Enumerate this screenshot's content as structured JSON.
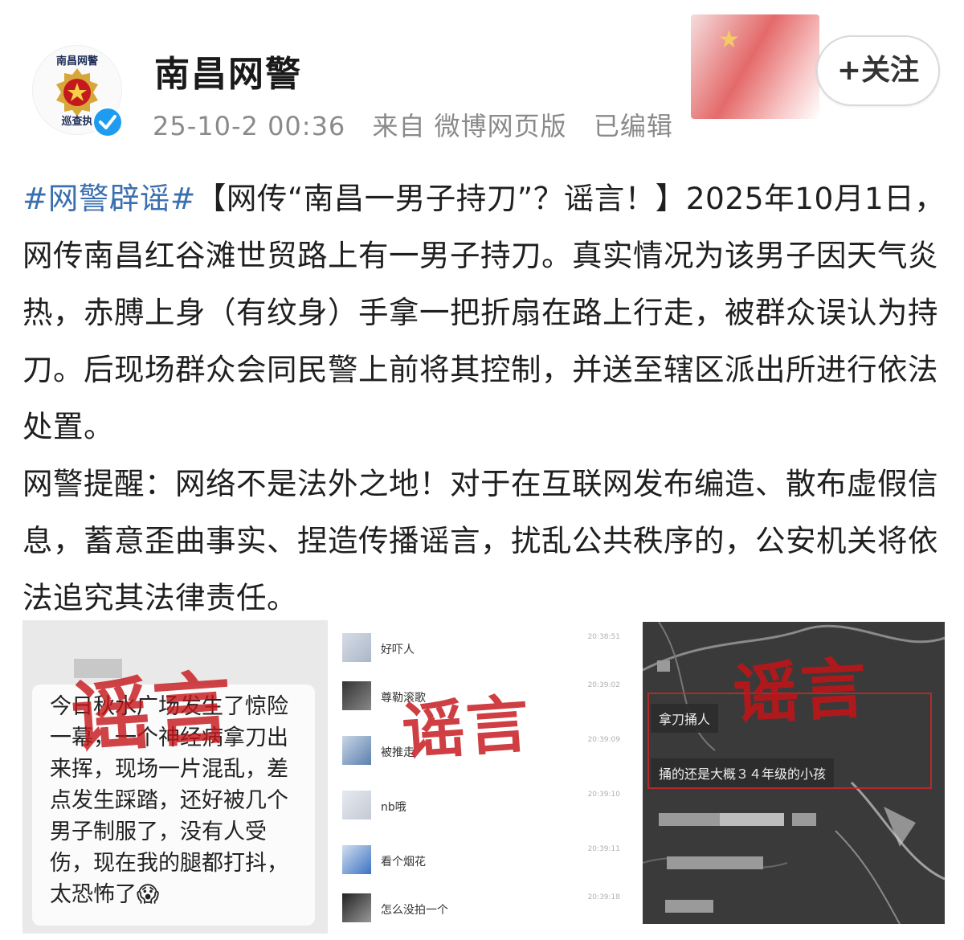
{
  "account": {
    "name": "南昌网警",
    "avatar_org_top": "南昌网警",
    "avatar_org_bottom": "巡查执",
    "verified_icon": "blue-verified-check",
    "banner_icon": "flag-banner-image",
    "follow_label": "+关注",
    "timestamp": "25-10-2 00:36",
    "source": "来自 微博网页版",
    "edited": "已编辑"
  },
  "post": {
    "hashtag": "#网警辟谣#",
    "paragraph1": "【网传“南昌一男子持刀”？谣言！】2025年10月1日，网传南昌红谷滩世贸路上有一男子持刀。真实情况为该男子因天气炎热，赤膊上身（有纹身）手拿一把折扇在路上行走，被群众误认为持刀。后现场群众会同民警上前将其控制，并送至辖区派出所进行依法处置。",
    "paragraph2": "网警提醒：网络不是法外之地！对于在互联网发布编造、散布虚假信息，蓄意歪曲事实、捏造传播谣言，扰乱公共秩序的，公安机关将依法追究其法律责任。"
  },
  "images": {
    "stamp": "谣言",
    "image1": {
      "text": "今日秋水广场发生了惊险一幕，一个神经病拿刀出来挥，现场一片混乱，差点发生踩踏，还好被几个男子制服了，没有人受伤，现在我的腿都打抖，太恐怖了😱"
    },
    "image2": {
      "comments": [
        {
          "text": "好吓人",
          "time": "20:38:51"
        },
        {
          "text": "尊勒滚歌",
          "time": "20:39:02"
        },
        {
          "text": "被推走",
          "time": "20:39:09"
        },
        {
          "text": "nb哦",
          "time": "20:39:10"
        },
        {
          "text": "看个烟花",
          "time": "20:39:11"
        },
        {
          "text": "怎么没拍一个",
          "time": "20:39:18"
        }
      ]
    },
    "image3": {
      "bubble1": "拿刀捅人",
      "bubble2": "捅的还是大概３４年级的小孩"
    }
  }
}
